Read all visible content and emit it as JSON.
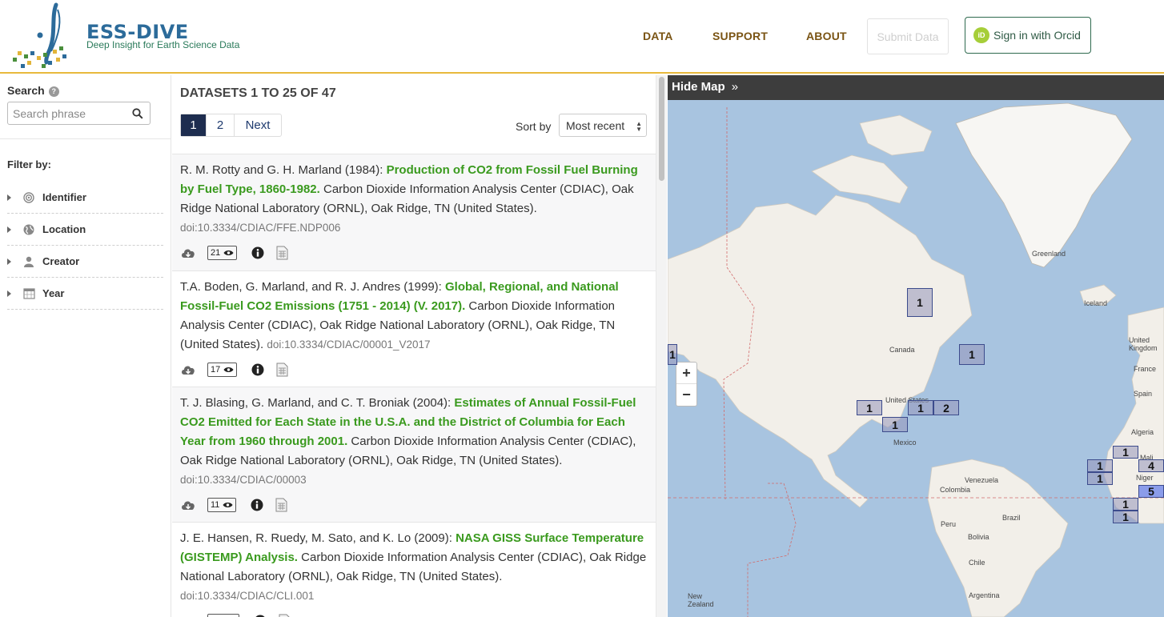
{
  "header": {
    "logo_title": "ESS-DIVE",
    "logo_subtitle": "Deep Insight for Earth Science Data",
    "nav": [
      {
        "label": "DATA"
      },
      {
        "label": "SUPPORT"
      },
      {
        "label": "ABOUT"
      }
    ],
    "submit_label": "Submit Data",
    "orcid_badge": "iD",
    "orcid_label": "Sign in with Orcid"
  },
  "sidebar": {
    "search_label": "Search",
    "search_help_icon": "?",
    "search_placeholder": "Search phrase",
    "search_value": "",
    "filter_label": "Filter by:",
    "filters": [
      {
        "label": "Identifier",
        "icon": "target-icon"
      },
      {
        "label": "Location",
        "icon": "globe-icon"
      },
      {
        "label": "Creator",
        "icon": "user-icon"
      },
      {
        "label": "Year",
        "icon": "calendar-icon"
      }
    ]
  },
  "results": {
    "heading": "DATASETS 1 TO 25 OF 47",
    "pages": [
      "1",
      "2",
      "Next"
    ],
    "active_page": "1",
    "sort_label": "Sort by",
    "sort_value": "Most recent",
    "records": [
      {
        "authors": "R. M. Rotty and G. H. Marland (1984): ",
        "title": "Production of CO2 from Fossil Fuel Burning by Fuel Type, 1860-1982.",
        "publisher": " Carbon Dioxide Information Analysis Center (CDIAC), Oak Ridge National Laboratory (ORNL), Oak Ridge, TN (United States).",
        "doi": "doi:10.3334/CDIAC/FFE.NDP006",
        "views": "21"
      },
      {
        "authors": "T.A. Boden, G. Marland, and R. J. Andres (1999): ",
        "title": "Global, Regional, and National Fossil-Fuel CO2 Emissions (1751 - 2014) (V. 2017).",
        "publisher": " Carbon Dioxide Information Analysis Center (CDIAC), Oak Ridge National Laboratory (ORNL), Oak Ridge, TN (United States).",
        "doi": "doi:10.3334/CDIAC/00001_V2017",
        "views": "17"
      },
      {
        "authors": "T. J. Blasing, G. Marland, and C. T. Broniak (2004): ",
        "title": "Estimates of Annual Fossil-Fuel CO2 Emitted for Each State in the U.S.A. and the District of Columbia for Each Year from 1960 through 2001.",
        "publisher": " Carbon Dioxide Information Analysis Center (CDIAC), Oak Ridge National Laboratory (ORNL), Oak Ridge, TN (United States).",
        "doi": "doi:10.3334/CDIAC/00003",
        "views": "11"
      },
      {
        "authors": "J. E. Hansen, R. Ruedy, M. Sato, and K. Lo (2009): ",
        "title": "NASA GISS Surface Temperature (GISTEMP) Analysis.",
        "publisher": " Carbon Dioxide Information Analysis Center (CDIAC), Oak Ridge National Laboratory (ORNL), Oak Ridge, TN (United States).",
        "doi": "doi:10.3334/CDIAC/CLI.001",
        "views": ""
      }
    ]
  },
  "map": {
    "toggle_label": "Hide Map",
    "toggle_icon": "»",
    "zoom_in": "+",
    "zoom_out": "−",
    "labels": {
      "greenland": "Greenland",
      "iceland": "Iceland",
      "canada": "Canada",
      "united_states": "United States",
      "mexico": "Mexico",
      "united_kingdom": "United Kingdom",
      "france": "France",
      "spain": "Spain",
      "algeria": "Algeria",
      "mali": "Mali",
      "niger": "Niger",
      "venezuela": "Venezuela",
      "colombia": "Colombia",
      "brazil": "Brazil",
      "peru": "Peru",
      "bolivia": "Bolivia",
      "chile": "Chile",
      "argentina": "Argentina",
      "new_zealand": "New Zealand"
    },
    "clusters": [
      "1",
      "1",
      "1",
      "1",
      "1",
      "1",
      "2",
      "1",
      "1",
      "1",
      "4",
      "5",
      "1",
      "1"
    ]
  }
}
